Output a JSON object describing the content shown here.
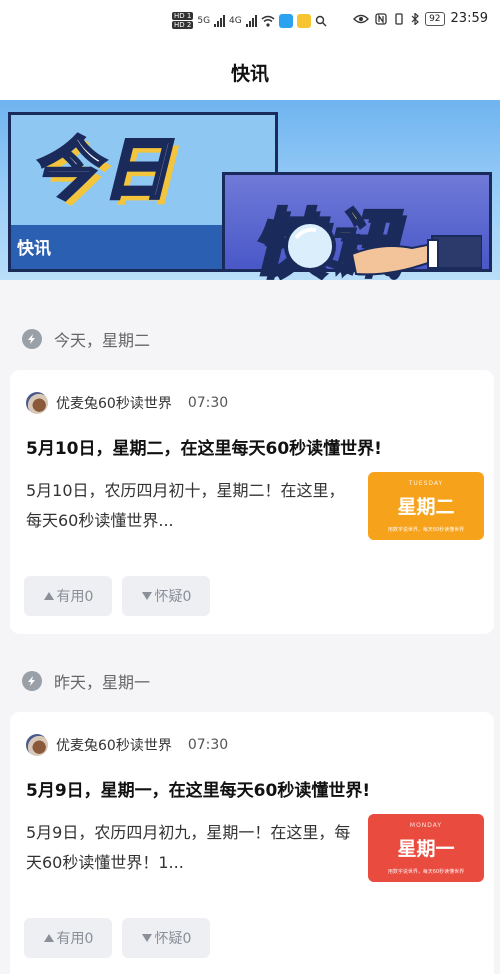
{
  "status_bar": {
    "left_badges": [
      "HD 1",
      "HD 2"
    ],
    "network": [
      "5G",
      "4G"
    ],
    "battery": "92",
    "time": "23:59"
  },
  "nav": {
    "title": "快讯"
  },
  "banner": {
    "title_line1": "今日",
    "title_line2": "快讯",
    "small_label": "快讯"
  },
  "sections": [
    {
      "label": "今天，星期二",
      "card": {
        "source": "优麦兔60秒读世界",
        "time": "07:30",
        "headline": "5月10日，星期二，在这里每天60秒读懂世界!",
        "summary": "5月10日，农历四月初十，星期二！在这里，每天60秒读懂世界...",
        "thumb": {
          "small": "TUESDAY",
          "main": "星期二",
          "line": "用数字说世界，每天60秒读懂世界",
          "color": "#f7a21b"
        },
        "useful_label": "有用0",
        "doubt_label": "怀疑0"
      }
    },
    {
      "label": "昨天，星期一",
      "card": {
        "source": "优麦兔60秒读世界",
        "time": "07:30",
        "headline": "5月9日，星期一，在这里每天60秒读懂世界!",
        "summary": "5月9日，农历四月初九，星期一！在这里，每天60秒读懂世界！1...",
        "thumb": {
          "small": "MONDAY",
          "main": "星期一",
          "line": "用数字说世界，每天60秒读懂世界",
          "color": "#e94b3f"
        },
        "useful_label": "有用0",
        "doubt_label": "怀疑0"
      }
    }
  ]
}
